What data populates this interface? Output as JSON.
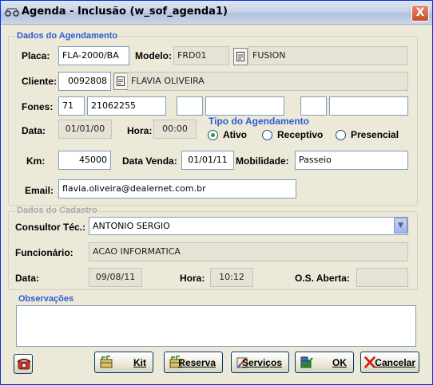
{
  "window": {
    "title": "Agenda - Inclusão (w_sof_agenda1)",
    "close_label": "X"
  },
  "agendamento": {
    "group_title": "Dados do Agendamento",
    "placa_label": "Placa:",
    "placa_value": "FLA-2000/BA",
    "modelo_label": "Modelo:",
    "modelo_code": "FRD01",
    "modelo_name": "FUSION",
    "cliente_label": "Cliente:",
    "cliente_code": "0092808",
    "cliente_name": "FLAVIA OLIVEIRA",
    "fones_label": "Fones:",
    "fone1_ddd": "71",
    "fone1_num": "21062255",
    "fone2_ddd": "",
    "fone2_num": "",
    "fone3_ddd": "",
    "fone3_num": "",
    "data_label": "Data:",
    "data_value": "01/01/00",
    "hora_label": "Hora:",
    "hora_value": "00:00",
    "tipo_title": "Tipo do Agendamento",
    "tipo_options": [
      "Ativo",
      "Receptivo",
      "Presencial"
    ],
    "tipo_selected": "Ativo",
    "km_label": "Km:",
    "km_value": "45000",
    "data_venda_label": "Data Venda:",
    "data_venda_value": "01/01/11",
    "mobilidade_label": "Mobilidade:",
    "mobilidade_value": "Passeio",
    "email_label": "Email:",
    "email_value": "flavia.oliveira@dealernet.com.br"
  },
  "cadastro": {
    "group_title": "Dados do Cadastro",
    "consultor_label": "Consultor Téc.:",
    "consultor_value": "ANTONIO SERGIO",
    "funcionario_label": "Funcionário:",
    "funcionario_value": "ACAO INFORMATICA",
    "data_label": "Data:",
    "data_value": "09/08/11",
    "hora_label": "Hora:",
    "hora_value": "10:12",
    "os_label": "O.S. Aberta:",
    "os_value": ""
  },
  "observacoes": {
    "group_title": "Observações",
    "value": ""
  },
  "buttons": {
    "kit": "Kit",
    "reserva": "Reserva",
    "servicos": "Serviços",
    "ok": "OK",
    "cancelar": "Cancelar"
  },
  "colors": {
    "accent_blue": "#2c5bd6",
    "window_bg": "#ece9d8",
    "close_red": "#c84d2c",
    "radio_green": "#21a121"
  }
}
